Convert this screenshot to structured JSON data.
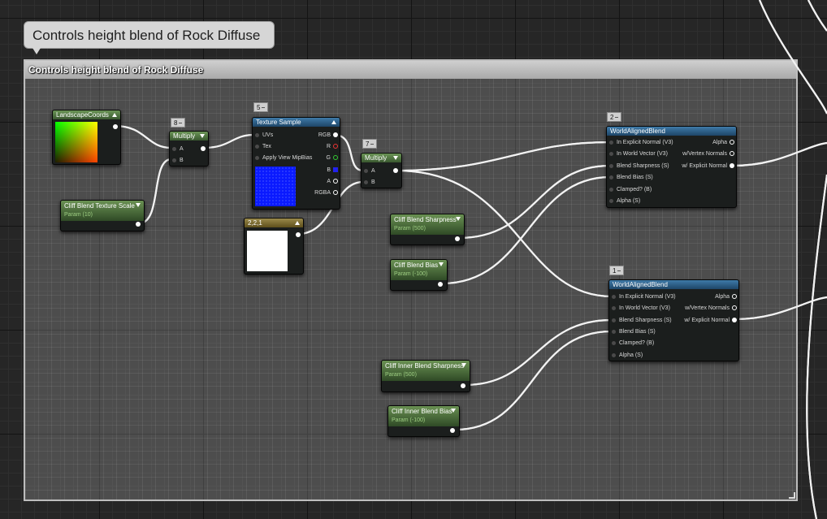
{
  "comment": {
    "bubble_text": "Controls height blend of Rock Diffuse",
    "header_text": "Controls height blend of Rock Diffuse"
  },
  "nodes": {
    "landscape_coords": {
      "title": "LandscapeCoords"
    },
    "multiply1": {
      "title": "Multiply",
      "tag": "8",
      "pins": [
        "A",
        "B"
      ]
    },
    "cliff_blend_texture_scale": {
      "title": "Cliff Blend Texture Scale",
      "subtitle": "Param (10)"
    },
    "texture_sample": {
      "title": "Texture Sample",
      "tag": "5",
      "inputs": [
        "UVs",
        "Tex",
        "Apply View MipBias"
      ],
      "outputs": [
        "RGB",
        "R",
        "G",
        "B",
        "A",
        "RGBA"
      ]
    },
    "constant3": {
      "title": "2,2,1"
    },
    "multiply2": {
      "title": "Multiply",
      "tag": "7",
      "pins": [
        "A",
        "B"
      ]
    },
    "cliff_blend_sharpness": {
      "title": "Cliff Blend Sharpness",
      "subtitle": "Param (500)"
    },
    "cliff_blend_bias": {
      "title": "Cliff Blend Bias",
      "subtitle": "Param (-100)"
    },
    "cliff_inner_blend_sharpness": {
      "title": "Cliff Inner Blend Sharpness",
      "subtitle": "Param (500)"
    },
    "cliff_inner_blend_bias": {
      "title": "Cliff Inner Blend Bias",
      "subtitle": "Param (-100)"
    },
    "world_aligned_blend_1": {
      "title": "WorldAlignedBlend",
      "tag": "2",
      "inputs": [
        "In Explicit Normal (V3)",
        "In World Vector (V3)",
        "Blend Sharpness (S)",
        "Blend Bias (S)",
        "Clamped? (B)",
        "Alpha (S)"
      ],
      "outputs": [
        "Alpha",
        "w/Vertex Normals",
        "w/ Explicit Normal"
      ]
    },
    "world_aligned_blend_2": {
      "title": "WorldAlignedBlend",
      "tag": "1",
      "inputs": [
        "In Explicit Normal (V3)",
        "In World Vector (V3)",
        "Blend Sharpness (S)",
        "Blend Bias (S)",
        "Clamped? (B)",
        "Alpha (S)"
      ],
      "outputs": [
        "Alpha",
        "w/Vertex Normals",
        "w/ Explicit Normal"
      ]
    }
  },
  "colors": {
    "canvas": "#262626",
    "wire": "#ffffff",
    "texture_preview": "#0a1aff",
    "constant_preview": "#ffffff"
  },
  "icons": [
    "collapse-arrow-icon",
    "expand-arrow-icon",
    "pin-dot-icon",
    "pin-ring-icon",
    "resize-grip-icon"
  ]
}
